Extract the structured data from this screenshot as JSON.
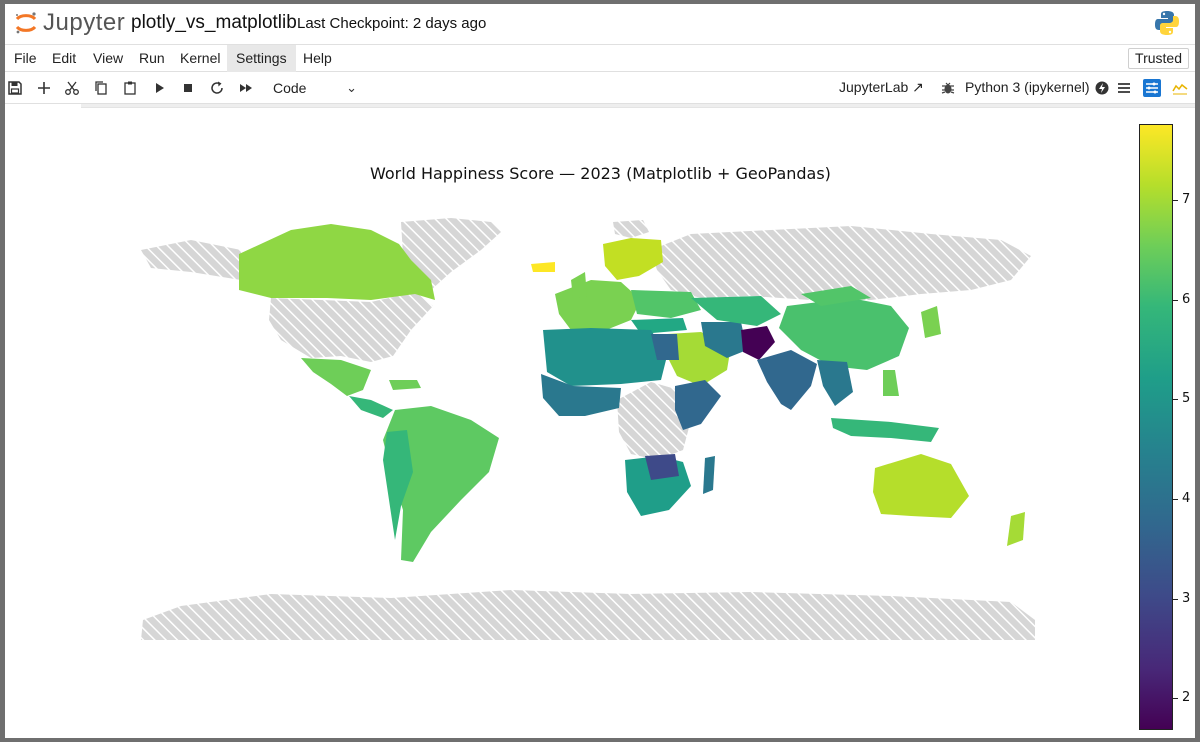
{
  "header": {
    "brand": "Jupyter",
    "notebook_title": "plotly_vs_matplotlib",
    "checkpoint": "Last Checkpoint: 2 days ago"
  },
  "menu": {
    "items": [
      "File",
      "Edit",
      "View",
      "Run",
      "Kernel",
      "Settings",
      "Help"
    ],
    "active": "Settings",
    "trusted": "Trusted"
  },
  "toolbar": {
    "icons": [
      "save-icon",
      "add-cell-icon",
      "cut-icon",
      "copy-icon",
      "paste-icon",
      "run-icon",
      "stop-icon",
      "restart-icon",
      "fast-forward-icon"
    ],
    "cell_type": "Code",
    "jupyterlab_link": "JupyterLab",
    "kernel": "Python 3 (ipykernel)"
  },
  "chart_data": {
    "type": "choropleth",
    "title": "World Happiness Score — 2023 (Matplotlib + GeoPandas)",
    "colormap": "viridis",
    "missing_data_style": "light gray hatched",
    "colorbar": {
      "ticks": [
        2,
        3,
        4,
        5,
        6,
        7
      ],
      "range": [
        1.6,
        7.8
      ]
    },
    "colors": {
      "low": "#440154",
      "high": "#fde725",
      "missing": "#d9d9d9"
    }
  }
}
